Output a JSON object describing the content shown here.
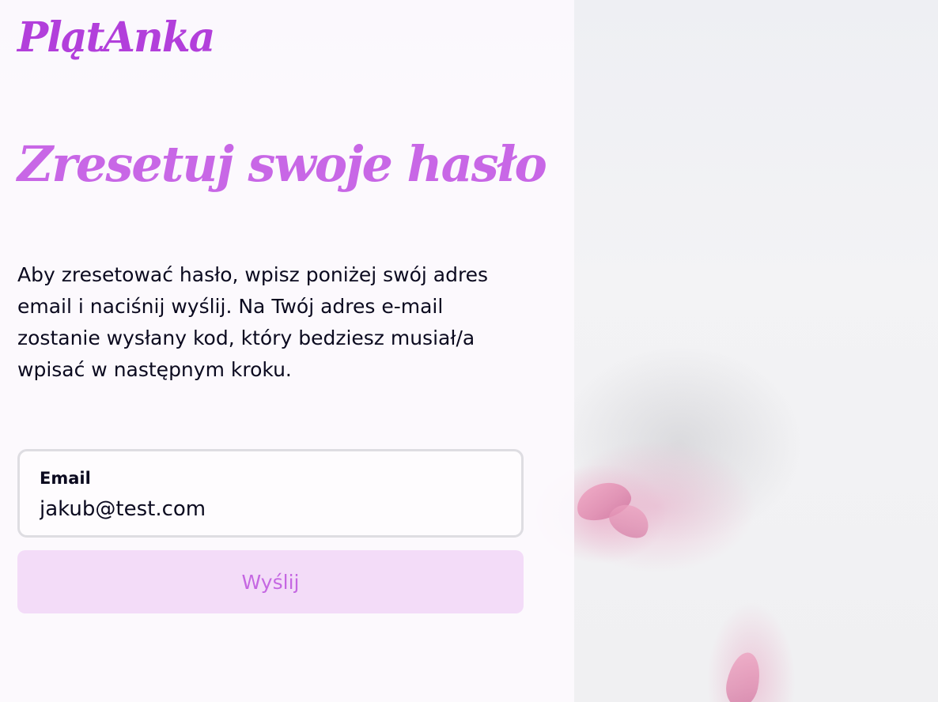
{
  "brand": {
    "logo_text": "PlątAnka"
  },
  "page": {
    "heading": "Zresetuj swoje hasło",
    "description": "Aby zresetować hasło, wpisz poniżej swój adres email i naciśnij wyślij. Na Twój adres e-mail zostanie wysłany kod, który bedziesz musiał/a wpisać w następnym kroku."
  },
  "form": {
    "email_label": "Email",
    "email_value": "jakub@test.com",
    "submit_label": "Wyślij"
  },
  "colors": {
    "brand": "#b23fdb",
    "heading": "#c867e6",
    "button_bg": "#f3dcf8",
    "button_text": "#c567e2"
  }
}
